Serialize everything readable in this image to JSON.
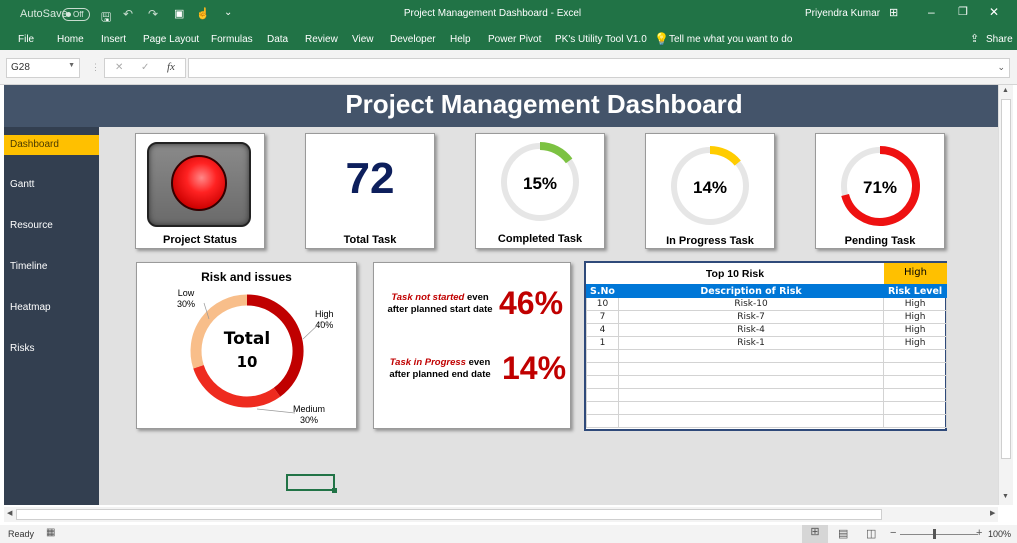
{
  "window": {
    "title": "Project Management Dashboard  -  Excel",
    "autosave_label": "AutoSave",
    "autosave_state": "Off",
    "user": "Priyendra Kumar",
    "share_label": "Share"
  },
  "ribbon": {
    "tabs": [
      "File",
      "Home",
      "Insert",
      "Page Layout",
      "Formulas",
      "Data",
      "Review",
      "View",
      "Developer",
      "Help",
      "Power Pivot",
      "PK's Utility Tool V1.0"
    ],
    "tell_me": "Tell me what you want to do"
  },
  "formula_bar": {
    "name_box": "G28",
    "formula": ""
  },
  "dashboard": {
    "title": "Project Management Dashboard",
    "sidebar": [
      {
        "label": "Dashboard",
        "active": true
      },
      {
        "label": "Gantt",
        "active": false
      },
      {
        "label": "Resource",
        "active": false
      },
      {
        "label": "Timeline",
        "active": false
      },
      {
        "label": "Heatmap",
        "active": false
      },
      {
        "label": "Risks",
        "active": false
      }
    ],
    "kpis": {
      "project_status": {
        "label": "Project Status",
        "state": "red"
      },
      "total_task": {
        "label": "Total Task",
        "value": "72"
      },
      "completed": {
        "label": "Completed Task",
        "value": "15%",
        "pct": 15,
        "color": "#7cc242"
      },
      "in_progress": {
        "label": "In Progress Task",
        "value": "14%",
        "pct": 14,
        "color": "#ffcc00"
      },
      "pending": {
        "label": "Pending Task",
        "value": "71%",
        "pct": 71,
        "color": "#ee1111"
      }
    },
    "risk_issues": {
      "title": "Risk and issues",
      "center_label": "Total",
      "center_value": "10",
      "slices": [
        {
          "name": "High",
          "pct": "40%",
          "value": 40,
          "color": "#c00000"
        },
        {
          "name": "Medium",
          "pct": "30%",
          "value": 30,
          "color": "#ee2b1f"
        },
        {
          "name": "Low",
          "pct": "30%",
          "value": 30,
          "color": "#f8be8a"
        }
      ]
    },
    "delays": [
      {
        "highlight": "Task not started",
        "rest1": " even",
        "rest2": "after planned start date",
        "value": "46%"
      },
      {
        "highlight": "Task in Progress",
        "rest1": " even",
        "rest2": "after planned end date",
        "value": "14%"
      }
    ],
    "top_risk": {
      "title": "Top 10 Risk",
      "filter": "High",
      "headers": [
        "S.No",
        "Description of Risk",
        "Risk Level"
      ],
      "rows": [
        [
          "10",
          "Risk-10",
          "High"
        ],
        [
          "7",
          "Risk-7",
          "High"
        ],
        [
          "4",
          "Risk-4",
          "High"
        ],
        [
          "1",
          "Risk-1",
          "High"
        ],
        [
          "",
          "",
          ""
        ],
        [
          "",
          "",
          ""
        ],
        [
          "",
          "",
          ""
        ],
        [
          "",
          "",
          ""
        ],
        [
          "",
          "",
          ""
        ],
        [
          "",
          "",
          ""
        ]
      ]
    }
  },
  "status_bar": {
    "status": "Ready",
    "zoom": "100%"
  }
}
